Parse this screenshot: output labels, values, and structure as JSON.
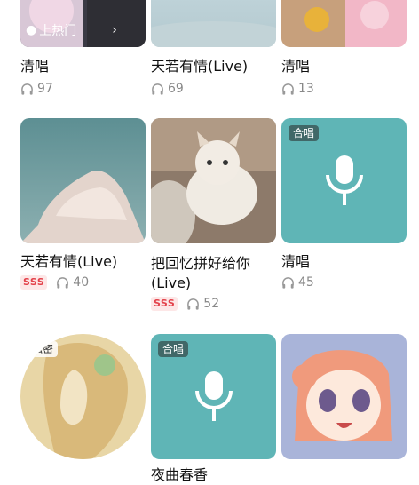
{
  "cards": [
    {
      "title": "清唱",
      "plays": "97",
      "badge": "上热门"
    },
    {
      "title": "天若有情(Live)",
      "plays": "69"
    },
    {
      "title": "清唱",
      "plays": "13"
    },
    {
      "title": "天若有情(Live)",
      "plays": "40",
      "rank": "SSS"
    },
    {
      "title_line1": "把回忆拼好给你",
      "title_line2": "(Live)",
      "plays": "52",
      "rank": "SSS"
    },
    {
      "title": "清唱",
      "plays": "45",
      "tag": "合唱"
    },
    {
      "tag": "私密"
    },
    {
      "tag": "合唱",
      "title_partial": "夜曲春香"
    },
    {}
  ],
  "colors": {
    "accent_rank": "#e3424b",
    "chorus_bg": "#5fb5b6"
  }
}
